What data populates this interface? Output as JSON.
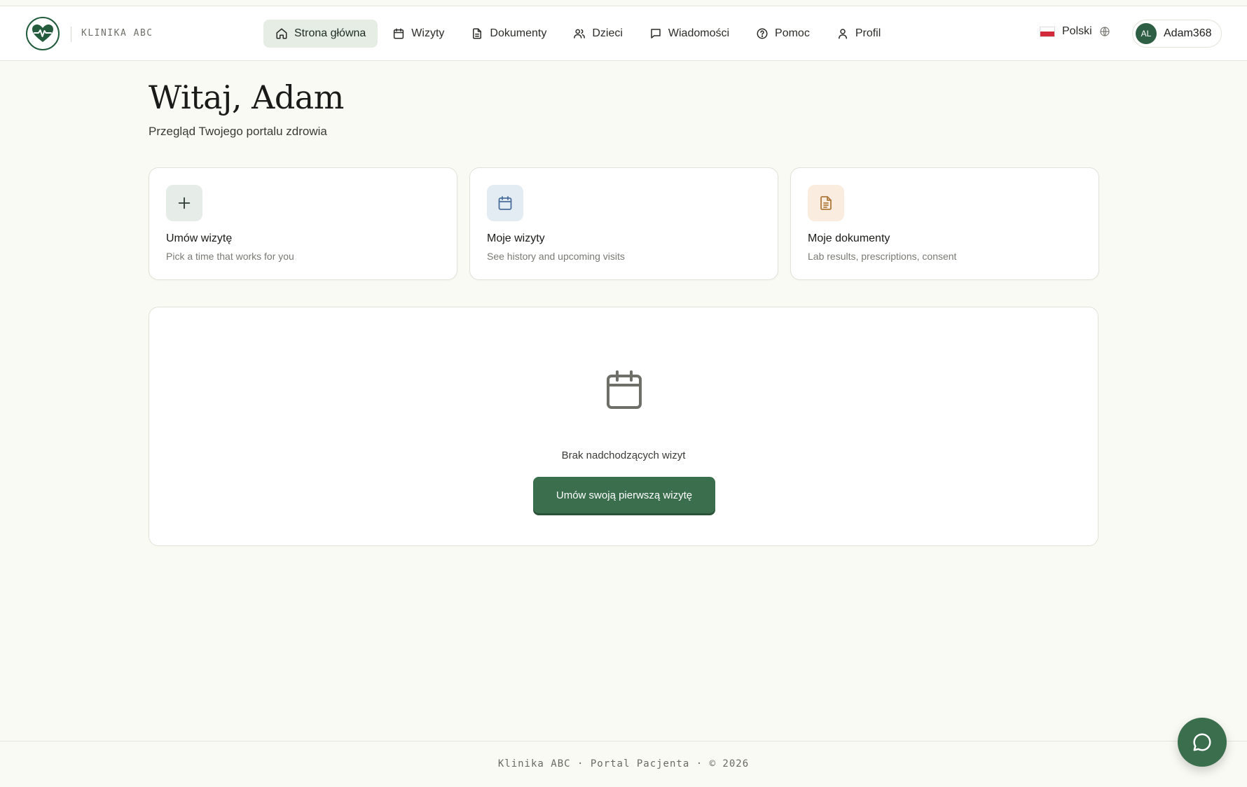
{
  "brand": {
    "name": "KLINIKA ABC"
  },
  "nav": {
    "items": [
      {
        "label": "Strona główna",
        "icon": "home-icon",
        "active": true
      },
      {
        "label": "Wizyty",
        "icon": "calendar-icon"
      },
      {
        "label": "Dokumenty",
        "icon": "document-icon"
      },
      {
        "label": "Dzieci",
        "icon": "users-icon"
      },
      {
        "label": "Wiadomości",
        "icon": "message-icon"
      },
      {
        "label": "Pomoc",
        "icon": "help-icon"
      },
      {
        "label": "Profil",
        "icon": "user-icon"
      }
    ]
  },
  "language": {
    "label": "Polski",
    "flag": "poland-flag-icon"
  },
  "user": {
    "initials": "AL",
    "username": "Adam368"
  },
  "hero": {
    "title": "Witaj, Adam",
    "subtitle": "Przegląd Twojego portalu zdrowia"
  },
  "cards": [
    {
      "title": "Umów wizytę",
      "desc": "Pick a time that works for you",
      "icon": "plus-icon",
      "icon_bg": "#e6ece7",
      "icon_color": "#2f3b33"
    },
    {
      "title": "Moje wizyty",
      "desc": "See history and upcoming visits",
      "icon": "calendar-icon",
      "icon_bg": "#e3ebf3",
      "icon_color": "#4a6f9a"
    },
    {
      "title": "Moje dokumenty",
      "desc": "Lab results, prescriptions, consent",
      "icon": "document-icon",
      "icon_bg": "#fbece0",
      "icon_color": "#b07a3c"
    }
  ],
  "upcoming": {
    "empty_text": "Brak nadchodzących wizyt",
    "cta_label": "Umów swoją pierwszą wizytę"
  },
  "footer": {
    "text": "Klinika ABC · Portal Pacjenta · © 2026"
  },
  "colors": {
    "primary": "#3a6e4d",
    "background": "#fafaf4"
  }
}
